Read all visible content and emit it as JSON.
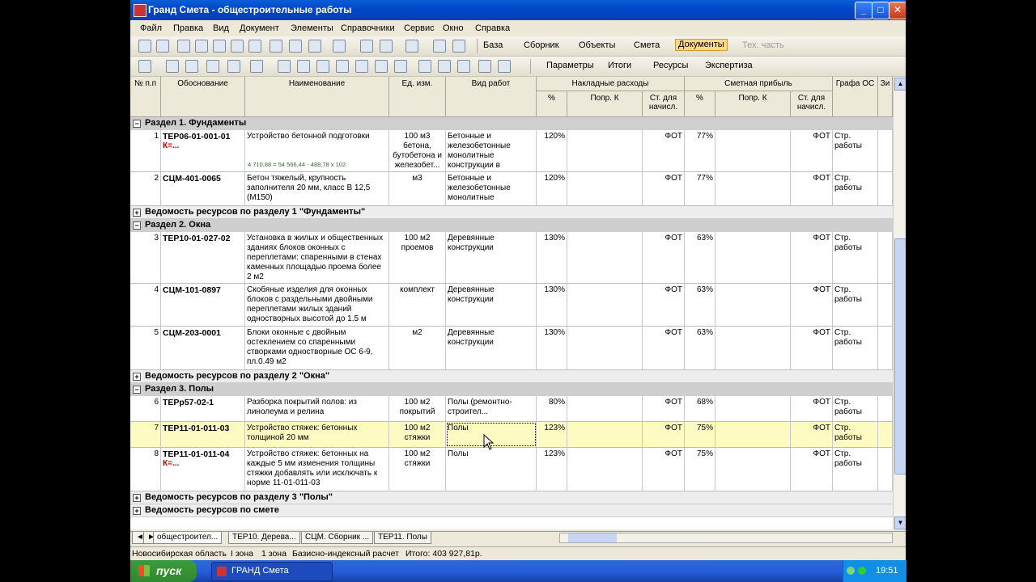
{
  "window": {
    "title": "Гранд Смета - общестроительные работы"
  },
  "menu": [
    "Файл",
    "Правка",
    "Вид",
    "Документ",
    "Элементы",
    "Справочники",
    "Сервис",
    "Окно",
    "Справка"
  ],
  "toolbar1": {
    "base": "База",
    "collection": "Сборник",
    "objects": "Объекты",
    "estimate": "Смета",
    "documents": "Документы",
    "tech": "Тех. часть"
  },
  "toolbar2": {
    "params": "Параметры",
    "totals": "Итоги",
    "resources": "Ресурсы",
    "expertise": "Экспертиза"
  },
  "columns": {
    "no": "№ п.п",
    "basis": "Обоснование",
    "name": "Наименование",
    "unit": "Ед. изм.",
    "work_type": "Вид работ",
    "overhead": "Накладные расходы",
    "profit": "Сметная прибыль",
    "pct": "%",
    "corr": "Попр. К",
    "base": "Ст. для начисл.",
    "os": "Графа ОС",
    "zi": "Зи"
  },
  "sections": [
    {
      "title": "Раздел 1. Фундаменты"
    },
    {
      "title": "Раздел 2. Окна"
    },
    {
      "title": "Раздел 3. Полы"
    }
  ],
  "resource_rows": [
    "Ведомость ресурсов по разделу 1 \"Фундаменты\"",
    "Ведомость ресурсов по разделу 2 \"Окна\"",
    "Ведомость ресурсов по разделу 3 \"Полы\"",
    "Ведомость ресурсов по смете"
  ],
  "rows": [
    {
      "n": "1",
      "code": "ТЕР06-01-001-01",
      "k": "К=...",
      "name": "Устройство бетонной подготовки",
      "formula": "4 710,88 = 54 566,44 - 488,78 x 102",
      "unit": "100 м3 бетона, бутобетона и железобет...",
      "work": "Бетонные и железобетонные монолитные конструкции в",
      "op": "120%",
      "ob": "ФОТ",
      "pp": "77%",
      "pb": "ФОТ",
      "os": "Стр. работы"
    },
    {
      "n": "2",
      "code": "СЦМ-401-0065",
      "k": "",
      "name": "Бетон тяжелый, крупность заполнителя 20 мм, класс В 12,5 (М150)",
      "formula": "",
      "unit": "м3",
      "work": "Бетонные и железобетонные монолитные",
      "op": "120%",
      "ob": "ФОТ",
      "pp": "77%",
      "pb": "ФОТ",
      "os": "Стр. работы"
    },
    {
      "n": "3",
      "code": "ТЕР10-01-027-02",
      "k": "",
      "name": "Установка в жилых и общественных зданиях блоков оконных с переплетами: спаренными в стенах каменных площадью проема более 2 м2",
      "formula": "",
      "unit": "100 м2 проемов",
      "work": "Деревянные конструкции",
      "op": "130%",
      "ob": "ФОТ",
      "pp": "63%",
      "pb": "ФОТ",
      "os": "Стр. работы"
    },
    {
      "n": "4",
      "code": "СЦМ-101-0897",
      "k": "",
      "name": "Скобяные изделия для оконных блоков с раздельными двойными переплетами жилых зданий одностворных высотой до 1.5 м",
      "formula": "",
      "unit": "комплект",
      "work": "Деревянные конструкции",
      "op": "130%",
      "ob": "ФОТ",
      "pp": "63%",
      "pb": "ФОТ",
      "os": "Стр. работы"
    },
    {
      "n": "5",
      "code": "СЦМ-203-0001",
      "k": "",
      "name": "Блоки оконные с двойным остеклением со спаренными створками одностворные ОС 6-9, пл.0.49 м2",
      "formula": "",
      "unit": "м2",
      "work": "Деревянные конструкции",
      "op": "130%",
      "ob": "ФОТ",
      "pp": "63%",
      "pb": "ФОТ",
      "os": "Стр. работы"
    },
    {
      "n": "6",
      "code": "ТЕРр57-02-1",
      "k": "",
      "name": "Разборка покрытий полов: из линолеума и релина",
      "formula": "",
      "unit": "100 м2 покрытий",
      "work": "Полы (ремонтно-строител...",
      "op": "80%",
      "ob": "ФОТ",
      "pp": "68%",
      "pb": "ФОТ",
      "os": "Стр. работы"
    },
    {
      "n": "7",
      "code": "ТЕР11-01-011-03",
      "k": "",
      "name": "Устройство стяжек: бетонных толщиной 20 мм",
      "formula": "",
      "unit": "100 м2 стяжки",
      "work": "Полы",
      "op": "123%",
      "ob": "ФОТ",
      "pp": "75%",
      "pb": "ФОТ",
      "os": "Стр. работы"
    },
    {
      "n": "8",
      "code": "ТЕР11-01-011-04",
      "k": "К=...",
      "name": "Устройство стяжек: бетонных на каждые 5 мм изменения толщины стяжки добавлять или исключать к норме 11-01-011-03",
      "formula": "",
      "unit": "100 м2 стяжки",
      "work": "Полы",
      "op": "123%",
      "ob": "ФОТ",
      "pp": "75%",
      "pb": "ФОТ",
      "os": "Стр. работы"
    }
  ],
  "tabs": [
    "общестроител...",
    "ТЕР10. Дерева...",
    "СЦМ. Сборник ...",
    "ТЕР11. Полы"
  ],
  "status": {
    "region": "Новосибирская область",
    "zone1": "I зона",
    "zone2": "1 зона",
    "method": "Базисно-индексный расчет",
    "total": "Итого: 403 927,81р."
  },
  "taskbar": {
    "start": "пуск",
    "task": "ГРАНД Смета",
    "clock": "19:51"
  }
}
